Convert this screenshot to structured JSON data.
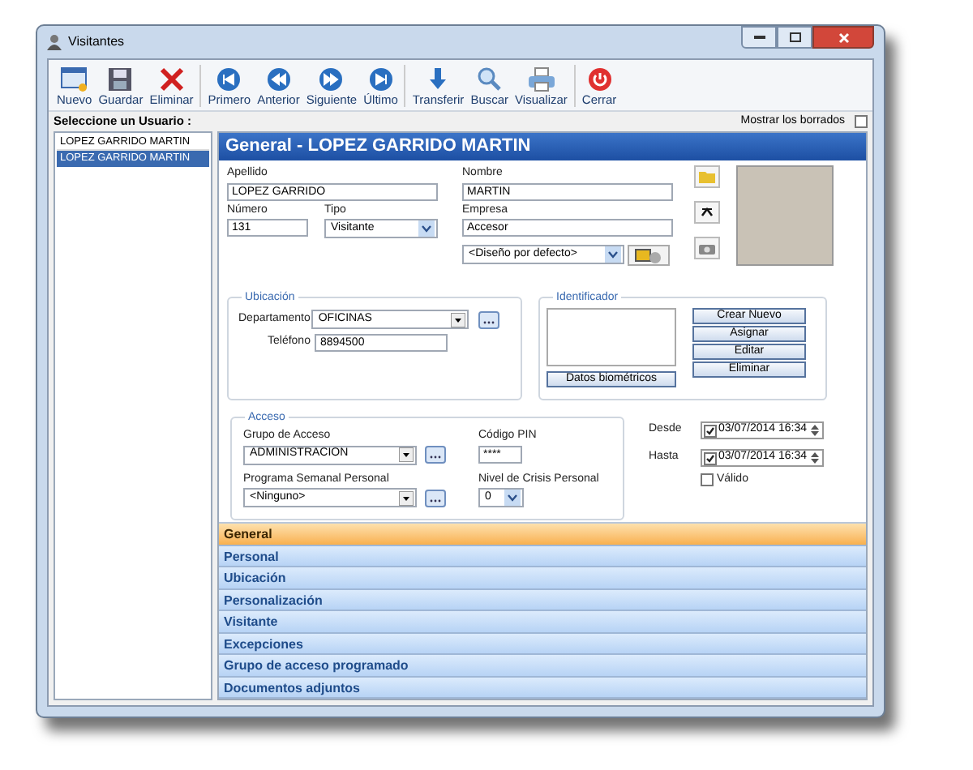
{
  "window": {
    "title": "Visitantes"
  },
  "toolbar": [
    {
      "label": "Nuevo"
    },
    {
      "label": "Guardar"
    },
    {
      "label": "Eliminar"
    },
    {
      "label": "Primero"
    },
    {
      "label": "Anterior"
    },
    {
      "label": "Siguiente"
    },
    {
      "label": "Último"
    },
    {
      "label": "Transferir"
    },
    {
      "label": "Buscar"
    },
    {
      "label": "Visualizar"
    },
    {
      "label": "Cerrar"
    }
  ],
  "user_list": {
    "label": "Seleccione un Usuario :",
    "items": [
      {
        "text": "LOPEZ GARRIDO MARTIN",
        "selected": false
      },
      {
        "text": "LOPEZ GARRIDO MARTIN",
        "selected": true
      }
    ]
  },
  "show_deleted": {
    "label": "Mostrar los borrados",
    "checked": false
  },
  "header": "General - LOPEZ GARRIDO MARTIN",
  "general": {
    "apellido": {
      "label": "Apellido",
      "value": "LOPEZ GARRIDO"
    },
    "nombre": {
      "label": "Nombre",
      "value": "MARTIN"
    },
    "numero": {
      "label": "Número",
      "value": "131"
    },
    "tipo": {
      "label": "Tipo",
      "value": "Visitante"
    },
    "empresa": {
      "label": "Empresa",
      "value": "Accesor"
    },
    "diseno": {
      "value": "<Diseño por defecto>"
    }
  },
  "ubicacion": {
    "title": "Ubicación",
    "departamento": {
      "label": "Departamento",
      "value": "OFICINAS"
    },
    "telefono": {
      "label": "Teléfono",
      "value": "8894500"
    }
  },
  "identificador": {
    "title": "Identificador",
    "biometric_button": "Datos biométricos",
    "buttons": [
      "Crear Nuevo",
      "Asignar",
      "Editar",
      "Eliminar"
    ]
  },
  "acceso": {
    "title": "Acceso",
    "grupo": {
      "label": "Grupo de Acceso",
      "value": "ADMINISTRACION"
    },
    "pin": {
      "label": "Código PIN",
      "value": "****"
    },
    "programa": {
      "label": "Programa Semanal Personal",
      "value": "<Ninguno>"
    },
    "crisis": {
      "label": "Nivel de Crisis Personal",
      "value": "0"
    }
  },
  "validity": {
    "desde": {
      "label": "Desde",
      "value": "03/07/2014 16:34",
      "checked": true
    },
    "hasta": {
      "label": "Hasta",
      "value": "03/07/2014 16:34",
      "checked": true
    },
    "valido": {
      "label": "Válido",
      "checked": false
    }
  },
  "sections": [
    {
      "label": "General",
      "selected": true
    },
    {
      "label": "Personal",
      "selected": false
    },
    {
      "label": "Ubicación",
      "selected": false
    },
    {
      "label": "Personalización",
      "selected": false
    },
    {
      "label": "Visitante",
      "selected": false
    },
    {
      "label": "Excepciones",
      "selected": false
    },
    {
      "label": "Grupo de acceso programado",
      "selected": false
    },
    {
      "label": "Documentos adjuntos",
      "selected": false
    }
  ]
}
